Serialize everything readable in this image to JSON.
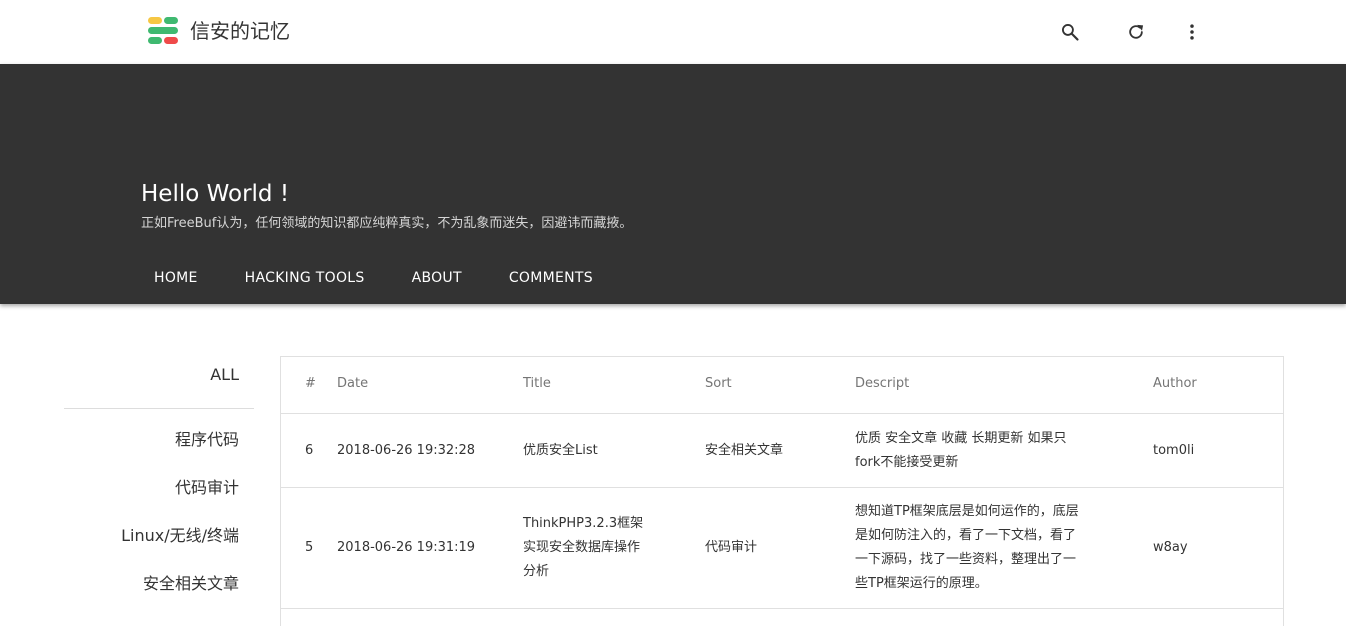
{
  "header": {
    "site_title": "信安的记忆",
    "logo_colors": [
      "#f6c744",
      "#3fb970",
      "#ef4a4a"
    ],
    "icons": [
      "search-icon",
      "refresh-icon",
      "more-vert-icon"
    ]
  },
  "hero": {
    "title": "Hello World !",
    "subtitle": "正如FreeBuf认为，任何领域的知识都应纯粹真实，不为乱象而迷失，因避讳而藏掖。",
    "background": "#333333",
    "nav": [
      "HOME",
      "HACKING TOOLS",
      "ABOUT",
      "COMMENTS"
    ]
  },
  "sidebar": {
    "all_label": "ALL",
    "categories": [
      "程序代码",
      "代码审计",
      "Linux/无线/终端",
      "安全相关文章"
    ]
  },
  "table": {
    "headers": [
      "#",
      "Date",
      "Title",
      "Sort",
      "Descript",
      "Author"
    ],
    "rows": [
      {
        "id": "6",
        "date": "2018-06-26 19:32:28",
        "title_lines": [
          "优质安全List"
        ],
        "sort": "安全相关文章",
        "desc_lines": [
          "优质 安全文章 收藏 长期更新 如果只",
          "fork不能接受更新"
        ],
        "author": "tom0li"
      },
      {
        "id": "5",
        "date": "2018-06-26 19:31:19",
        "title_lines": [
          "ThinkPHP3.2.3框架",
          "实现安全数据库操作",
          "分析"
        ],
        "sort": "代码审计",
        "desc_lines": [
          "想知道TP框架底层是如何运作的，底层",
          "是如何防注入的，看了一下文档，看了",
          "一下源码，找了一些资料，整理出了一",
          "些TP框架运行的原理。"
        ],
        "author": "w8ay"
      }
    ]
  }
}
